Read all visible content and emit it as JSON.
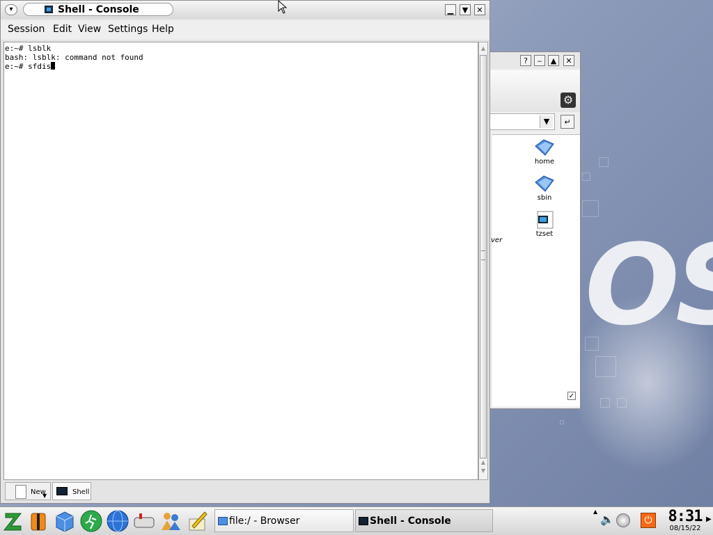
{
  "konsole": {
    "title": "Shell - Console",
    "menu": [
      "Session",
      "Edit",
      "View",
      "Settings",
      "Help"
    ],
    "terminal_lines": [
      "e:~# lsblk",
      "bash: lsblk: command not found"
    ],
    "prompt_line": "e:~# sfdis",
    "tabs": {
      "new_label": "New",
      "shell_label": "Shell"
    }
  },
  "browser": {
    "files": [
      {
        "name": "home",
        "icon": "folder-icon"
      },
      {
        "name": "sbin",
        "icon": "folder-icon"
      },
      {
        "name": "tzset",
        "icon": "executable-icon"
      }
    ],
    "partial_label": "ver"
  },
  "taskbar": {
    "tasks": [
      {
        "label": "file:/ - Browser",
        "icon": "folder-icon"
      },
      {
        "label": "Shell - Console",
        "icon": "terminal-icon"
      }
    ],
    "clock": {
      "time": "8:31",
      "date": "08/15/22"
    }
  },
  "colors": {
    "accent": "#3a7bd5",
    "terminal_bg": "#ffffff"
  }
}
